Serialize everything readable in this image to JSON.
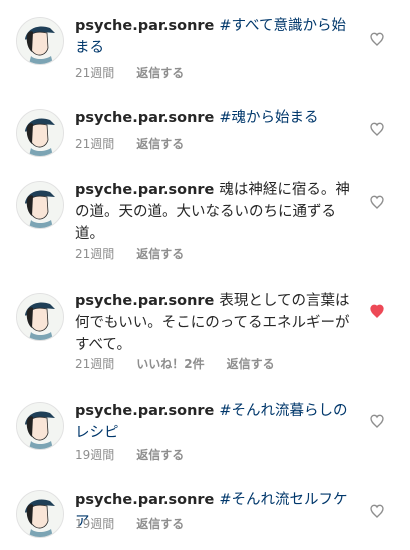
{
  "comments": [
    {
      "user": "psyche.par.sonre",
      "text": "#すべて意識から始まる",
      "is_tag": true,
      "time": "21週間",
      "likes": "",
      "reply": "返信する",
      "liked": false
    },
    {
      "user": "psyche.par.sonre",
      "text": "#魂から始まる",
      "is_tag": true,
      "time": "21週間",
      "likes": "",
      "reply": "返信する",
      "liked": false
    },
    {
      "user": "psyche.par.sonre",
      "text": "魂は神経に宿る。神の道。天の道。大いなるいのちに通ずる道。",
      "is_tag": false,
      "time": "21週間",
      "likes": "",
      "reply": "返信する",
      "liked": false
    },
    {
      "user": "psyche.par.sonre",
      "text": "表現としての言葉は何でもいい。そこにのってるエネルギーがすべて。",
      "is_tag": false,
      "time": "21週間",
      "likes": "いいね！2件",
      "reply": "返信する",
      "liked": true
    },
    {
      "user": "psyche.par.sonre",
      "text": "#そんれ流暮らしのレシピ",
      "is_tag": true,
      "time": "19週間",
      "likes": "",
      "reply": "返信する",
      "liked": false
    },
    {
      "user": "psyche.par.sonre",
      "text": "#そんれ流セルフケア",
      "is_tag": true,
      "time": "19週間",
      "likes": "",
      "reply": "返信する",
      "liked": false
    }
  ],
  "colors": {
    "username": "#262626",
    "hashtag": "#00376b",
    "meta": "#8e8e8e",
    "heart_liked": "#ed4956",
    "heart_empty": "#8e8e8e"
  },
  "icons": {
    "like": "heart-icon"
  }
}
